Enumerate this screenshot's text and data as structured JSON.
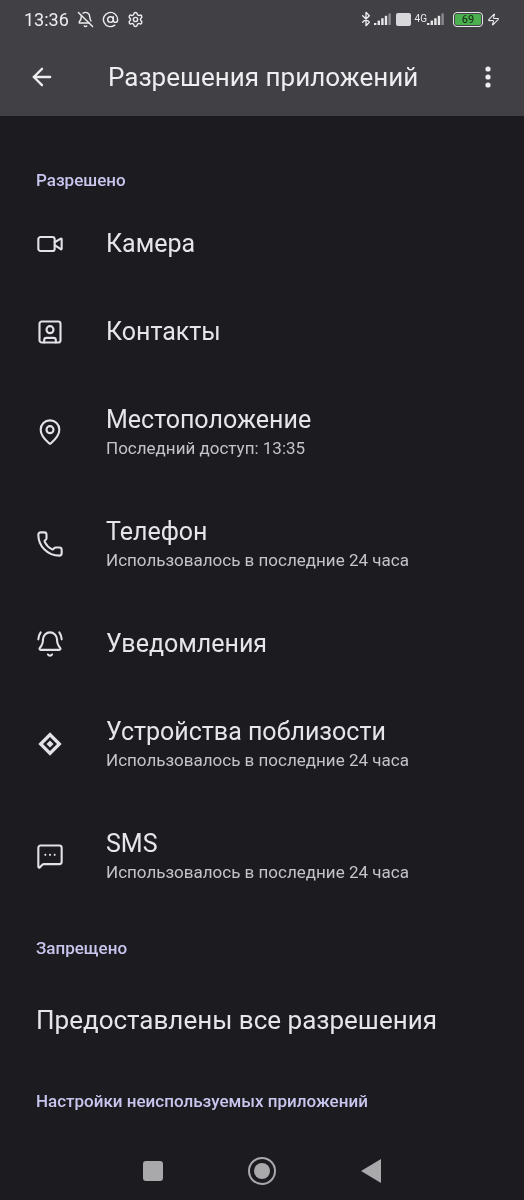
{
  "status_bar": {
    "time": "13:36",
    "network": "4G",
    "battery": "69"
  },
  "app_bar": {
    "title": "Разрешения приложений"
  },
  "sections": [
    {
      "header": "Разрешено",
      "items": [
        {
          "kind": "camera",
          "title": "Камера"
        },
        {
          "kind": "contacts",
          "title": "Контакты"
        },
        {
          "kind": "location",
          "title": "Местоположение",
          "subtitle": "Последний доступ: 13:35"
        },
        {
          "kind": "phone",
          "title": "Телефон",
          "subtitle": "Использовалось в последние 24 часа"
        },
        {
          "kind": "notifications",
          "title": "Уведомления"
        },
        {
          "kind": "nearby",
          "title": "Устройства поблизости",
          "subtitle": "Использовалось в последние 24 часа"
        },
        {
          "kind": "sms",
          "title": "SMS",
          "subtitle": "Использовалось в последние 24 часа"
        }
      ]
    },
    {
      "header": "Запрещено",
      "note": "Предоставлены все разрешения"
    }
  ],
  "footer_link": "Настройки неиспользуемых приложений"
}
